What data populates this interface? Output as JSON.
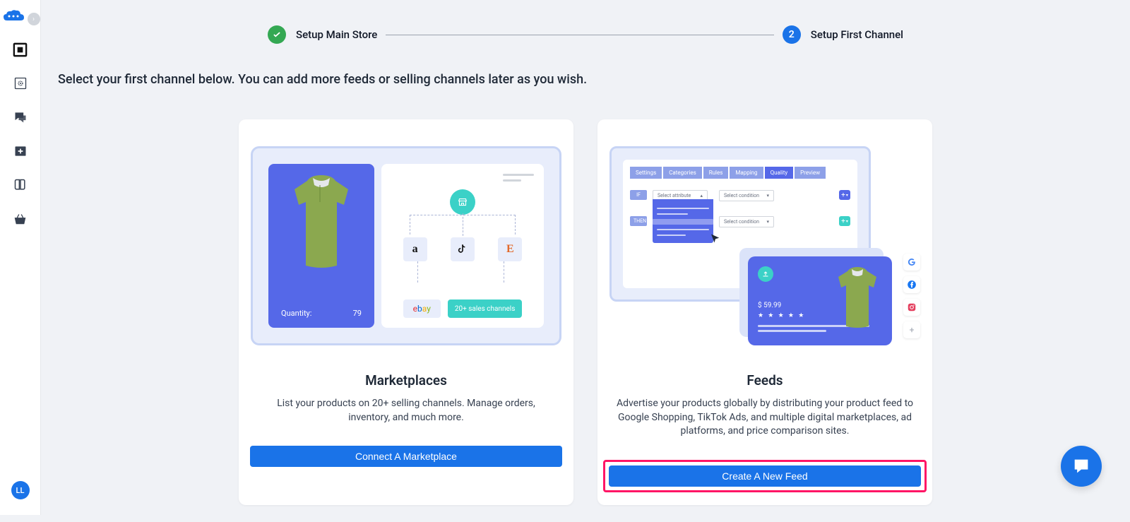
{
  "sidebar": {
    "avatar_initials": "LL"
  },
  "stepper": {
    "step1_label": "Setup Main Store",
    "step2_number": "2",
    "step2_label": "Setup First Channel"
  },
  "instruction": "Select your first channel below. You can add more feeds or selling channels later as you wish.",
  "cards": {
    "marketplaces": {
      "title": "Marketplaces",
      "description": "List your products on 20+ selling channels. Manage orders, inventory, and much more.",
      "button_label": "Connect A Marketplace",
      "illus": {
        "quantity_label": "Quantity:",
        "quantity_value": "79",
        "chip_label": "20+ sales channels"
      }
    },
    "feeds": {
      "title": "Feeds",
      "description": "Advertise your products globally by distributing your product feed to Google Shopping, TikTok Ads, and multiple digital marketplaces, ad platforms, and price comparison sites.",
      "button_label": "Create A New Feed",
      "illus": {
        "tabs": [
          "Settings",
          "Categories",
          "Rules",
          "Mapping",
          "Quality",
          "Preview"
        ],
        "pill_if": "IF",
        "pill_then": "THEN",
        "select_attr": "Select attribute",
        "select_cond": "Select condition",
        "price": "$ 59.99",
        "stars": "★ ★ ★ ★ ★"
      }
    }
  }
}
